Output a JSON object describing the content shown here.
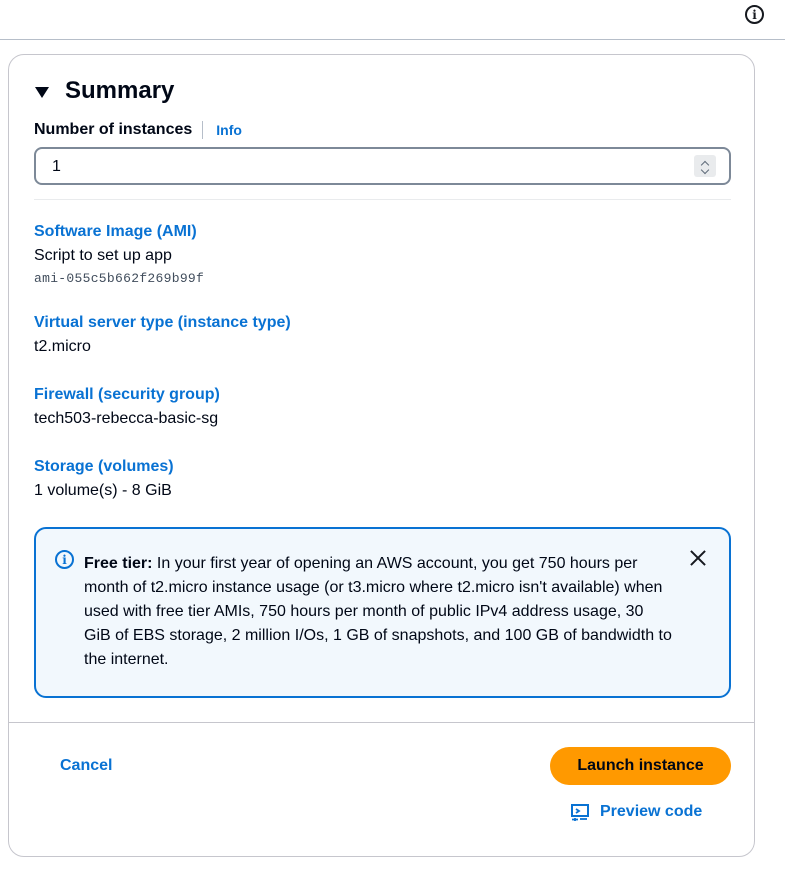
{
  "summary": {
    "title": "Summary",
    "instances_label": "Number of instances",
    "info_label": "Info",
    "instances_value": "1"
  },
  "details": [
    {
      "title": "Software Image (AMI)",
      "value": "Script to set up app",
      "sub": "ami-055c5b662f269b99f"
    },
    {
      "title": "Virtual server type (instance type)",
      "value": "t2.micro"
    },
    {
      "title": "Firewall (security group)",
      "value": "tech503-rebecca-basic-sg"
    },
    {
      "title": "Storage (volumes)",
      "value": "1 volume(s) - 8 GiB"
    }
  ],
  "alert": {
    "heading": "Free tier:",
    "body": "In your first year of opening an AWS account, you get 750 hours per month of t2.micro instance usage (or t3.micro where t2.micro isn't available) when used with free tier AMIs, 750 hours per month of public IPv4 address usage, 30 GiB of EBS storage, 2 million I/Os, 1 GB of snapshots, and 100 GB of bandwidth to the internet."
  },
  "footer": {
    "cancel_label": "Cancel",
    "launch_label": "Launch instance",
    "preview_label": "Preview code"
  },
  "colors": {
    "link": "#0972d3",
    "primary_button": "#ff9900",
    "alert_background": "#f2f8fd"
  },
  "icons": [
    "info-icon",
    "caret-down-icon",
    "stepper-icon",
    "close-icon",
    "code-preview-icon"
  ]
}
